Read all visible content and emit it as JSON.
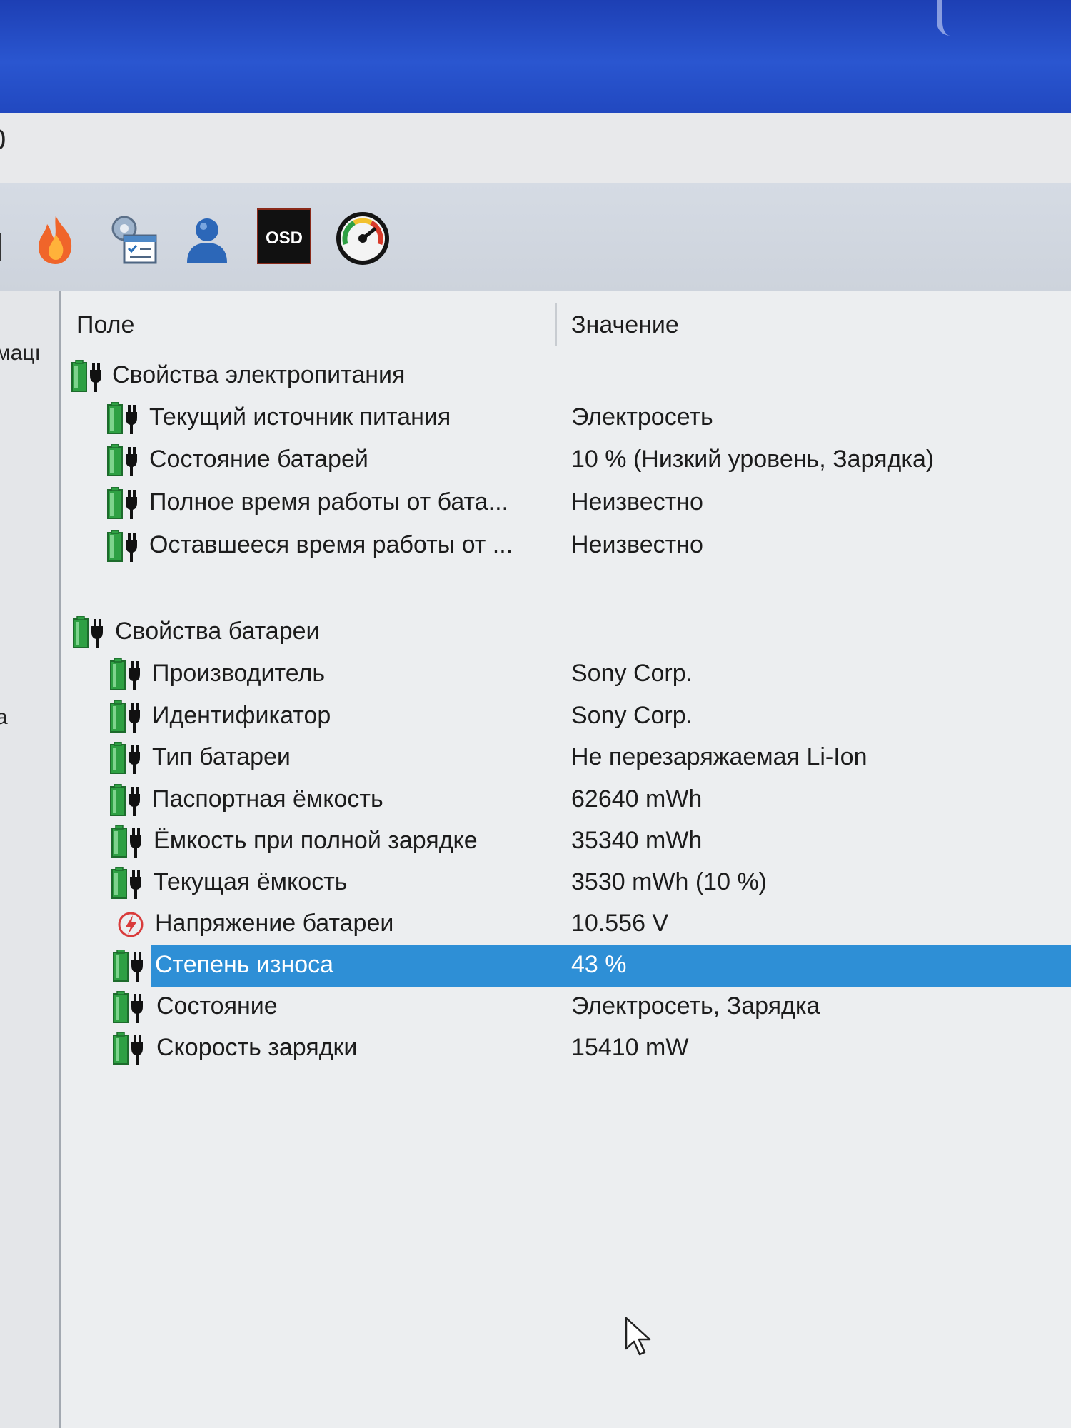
{
  "window": {
    "title_fragment": "0"
  },
  "toolbar": {
    "buttons": [
      {
        "icon": "flame-icon"
      },
      {
        "icon": "task-scheduler-icon"
      },
      {
        "icon": "user-icon"
      },
      {
        "icon": "osd-icon",
        "label": "OSD"
      },
      {
        "icon": "gauge-icon"
      }
    ]
  },
  "left_pane": {
    "fragments": [
      "мацı",
      "а"
    ]
  },
  "table": {
    "columns": {
      "field": "Поле",
      "value": "Значение"
    },
    "groups": [
      {
        "title": "Свойства электропитания",
        "rows": [
          {
            "field": "Текущий источник питания",
            "value": "Электросеть"
          },
          {
            "field": "Состояние батарей",
            "value": "10 % (Низкий уровень, Зарядка)"
          },
          {
            "field": "Полное время работы от бата...",
            "value": "Неизвестно"
          },
          {
            "field": "Оставшееся время работы от ...",
            "value": "Неизвестно"
          }
        ]
      },
      {
        "title": "Свойства батареи",
        "rows": [
          {
            "field": "Производитель",
            "value": "Sony Corp."
          },
          {
            "field": "Идентификатор",
            "value": "Sony Corp."
          },
          {
            "field": "Тип батареи",
            "value": "Не перезаряжаемая Li-Ion"
          },
          {
            "field": "Паспортная ёмкость",
            "value": "62640 mWh"
          },
          {
            "field": "Ёмкость при полной зарядке",
            "value": "35340 mWh"
          },
          {
            "field": "Текущая ёмкость",
            "value": "3530 mWh  (10 %)"
          },
          {
            "field": "Напряжение батареи",
            "value": "10.556 V",
            "icon": "voltage-icon"
          },
          {
            "field": "Степень износа",
            "value": "43 %",
            "selected": true
          },
          {
            "field": "Состояние",
            "value": "Электросеть, Зарядка"
          },
          {
            "field": "Скорость зарядки",
            "value": "15410 mW"
          }
        ]
      }
    ]
  },
  "colors": {
    "selection": "#2e8fd6",
    "battery_green": "#2ea043",
    "titlebar_blue": "#2148c0"
  }
}
